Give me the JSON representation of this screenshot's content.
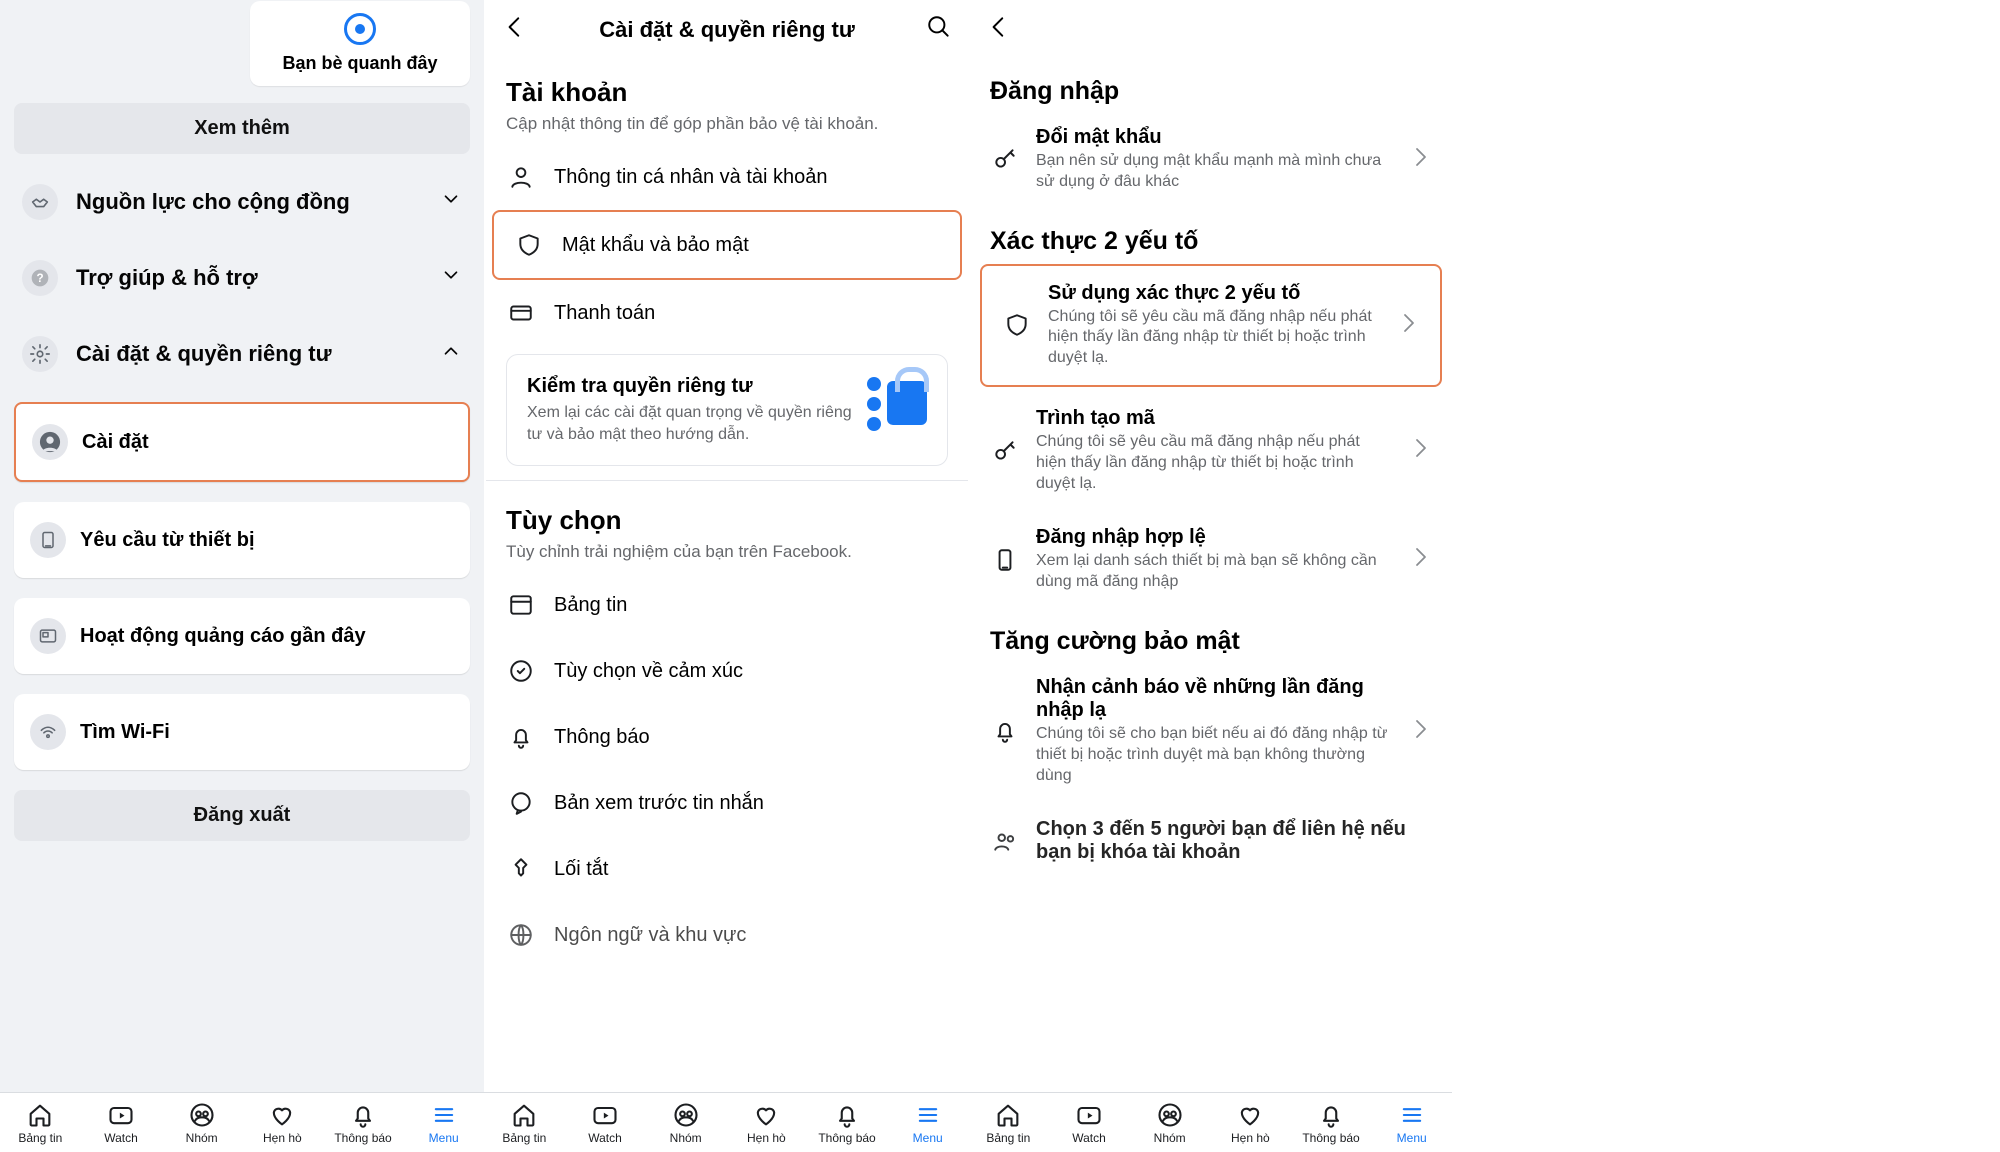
{
  "panel1": {
    "chip_friends_nearby": "Bạn bè quanh đây",
    "see_more": "Xem thêm",
    "menu": {
      "community": "Nguồn lực cho cộng đồng",
      "help": "Trợ giúp & hỗ trợ",
      "settings_privacy": "Cài đặt & quyền riêng tư"
    },
    "items": {
      "settings": "Cài đặt",
      "device_requests": "Yêu cầu từ thiết bị",
      "recent_ads": "Hoạt động quảng cáo gần đây",
      "find_wifi": "Tìm Wi-Fi"
    },
    "logout": "Đăng xuất"
  },
  "panel2": {
    "title": "Cài đặt & quyền riêng tư",
    "section_account": {
      "title": "Tài khoản",
      "sub": "Cập nhật thông tin để góp phần bảo vệ tài khoản."
    },
    "rows_account": {
      "personal": "Thông tin cá nhân và tài khoản",
      "password_security": "Mật khẩu và bảo mật",
      "payment": "Thanh toán"
    },
    "privacy_card": {
      "title": "Kiểm tra quyền riêng tư",
      "sub": "Xem lại các cài đặt quan trọng về quyền riêng tư và bảo mật theo hướng dẫn."
    },
    "section_prefs": {
      "title": "Tùy chọn",
      "sub": "Tùy chỉnh trải nghiệm của bạn trên Facebook."
    },
    "rows_prefs": {
      "feed": "Bảng tin",
      "reaction": "Tùy chọn về cảm xúc",
      "notif": "Thông báo",
      "msg_preview": "Bản xem trước tin nhắn",
      "shortcuts": "Lối tắt",
      "lang": "Ngôn ngữ và khu vực"
    }
  },
  "panel3": {
    "section_login": "Đăng nhập",
    "row_change_pw": {
      "title": "Đổi mật khẩu",
      "sub": "Bạn nên sử dụng mật khẩu mạnh mà mình chưa sử dụng ở đâu khác"
    },
    "section_2fa": "Xác thực 2 yếu tố",
    "row_2fa": {
      "title": "Sử dụng xác thực 2 yếu tố",
      "sub": "Chúng tôi sẽ yêu cầu mã đăng nhập nếu phát hiện thấy lần đăng nhập từ thiết bị hoặc trình duyệt lạ."
    },
    "row_code_gen": {
      "title": "Trình tạo mã",
      "sub": "Chúng tôi sẽ yêu cầu mã đăng nhập nếu phát hiện thấy lần đăng nhập từ thiết bị hoặc trình duyệt lạ."
    },
    "row_valid_login": {
      "title": "Đăng nhập hợp lệ",
      "sub": "Xem lại danh sách thiết bị mà bạn sẽ không cần dùng mã đăng nhập"
    },
    "section_extra": "Tăng cường bảo mật",
    "row_alerts": {
      "title": "Nhận cảnh báo về những lần đăng nhập lạ",
      "sub": "Chúng tôi sẽ cho bạn biết nếu ai đó đăng nhập từ thiết bị hoặc trình duyệt mà bạn không thường dùng"
    },
    "row_friends": {
      "title": "Chọn 3 đến 5 người bạn để liên hệ nếu bạn bị khóa tài khoản"
    }
  },
  "tabs": {
    "feed": "Bảng tin",
    "watch": "Watch",
    "groups": "Nhóm",
    "dating": "Hẹn hò",
    "notif": "Thông báo",
    "menu": "Menu"
  }
}
